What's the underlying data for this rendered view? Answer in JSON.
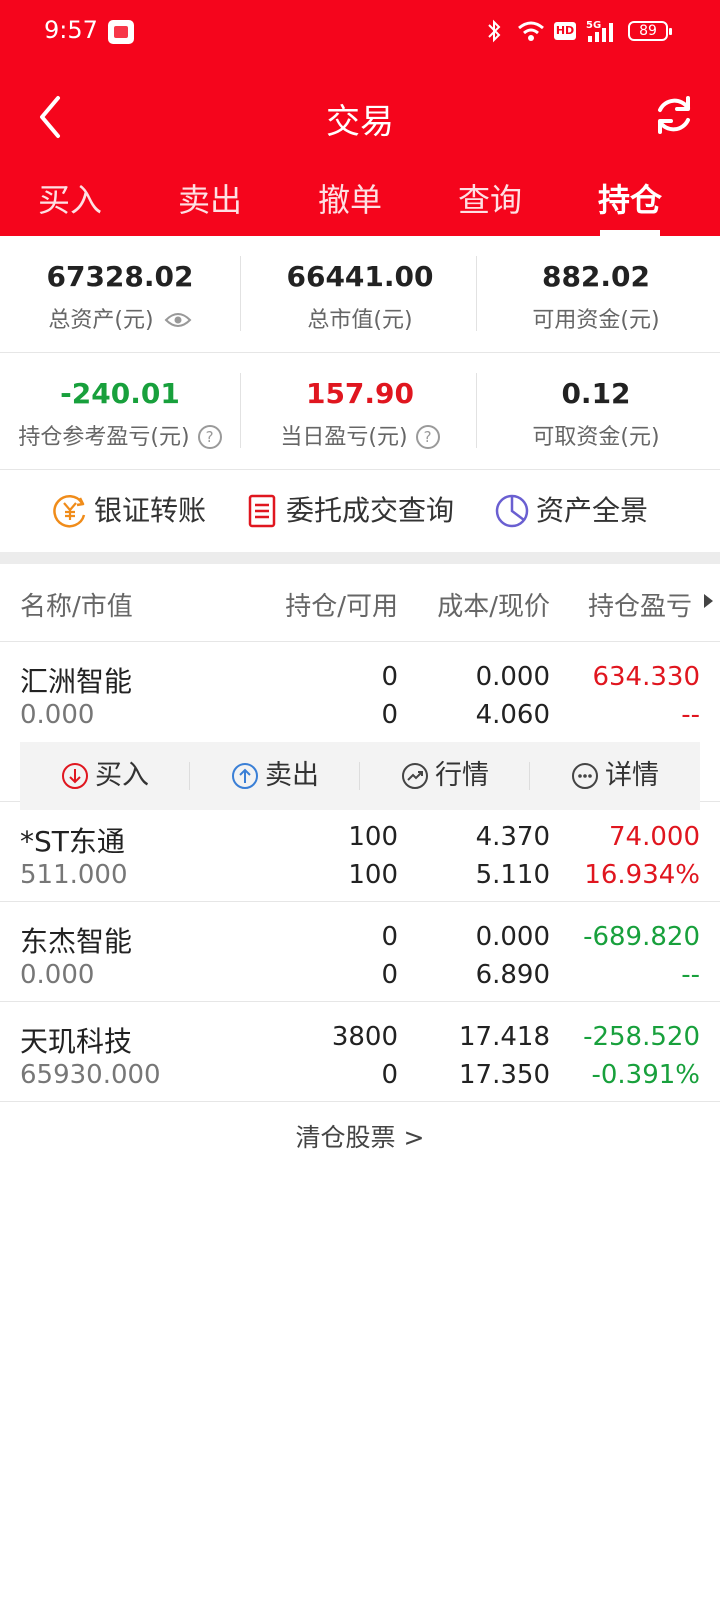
{
  "status_bar": {
    "time": "9:57",
    "battery": "89",
    "hd_label": "HD"
  },
  "header": {
    "title": "交易",
    "back_icon": "chevron-left-icon",
    "refresh_icon": "refresh-icon",
    "bg_color": "#f5051c"
  },
  "tabs": [
    {
      "label": "买入",
      "active": false
    },
    {
      "label": "卖出",
      "active": false
    },
    {
      "label": "撤单",
      "active": false
    },
    {
      "label": "查询",
      "active": false
    },
    {
      "label": "持仓",
      "active": true
    }
  ],
  "summary": {
    "total_assets": {
      "value": "67328.02",
      "label": "总资产(元)"
    },
    "market_value": {
      "value": "66441.00",
      "label": "总市值(元)"
    },
    "available_funds": {
      "value": "882.02",
      "label": "可用资金(元)"
    },
    "position_pnl": {
      "value": "-240.01",
      "label": "持仓参考盈亏(元)"
    },
    "daily_pnl": {
      "value": "157.90",
      "label": "当日盈亏(元)"
    },
    "withdrawable_funds": {
      "value": "0.12",
      "label": "可取资金(元)"
    }
  },
  "quick_actions": [
    {
      "label": "银证转账",
      "icon": "yuan-transfer-icon"
    },
    {
      "label": "委托成交查询",
      "icon": "document-list-icon"
    },
    {
      "label": "资产全景",
      "icon": "pie-chart-icon"
    }
  ],
  "table": {
    "headers": [
      "名称/市值",
      "持仓/可用",
      "成本/现价",
      "持仓盈亏"
    ],
    "rows": [
      {
        "name": "汇洲智能",
        "market_value": "0.000",
        "position": "0",
        "available": "0",
        "cost": "0.000",
        "price": "4.060",
        "pnl": "634.330",
        "pnl_pct": "--",
        "pnl_color": "red",
        "pct_color": "red",
        "expanded": true
      },
      {
        "name": "*ST东通",
        "market_value": "511.000",
        "position": "100",
        "available": "100",
        "cost": "4.370",
        "price": "5.110",
        "pnl": "74.000",
        "pnl_pct": "16.934%",
        "pnl_color": "red",
        "pct_color": "red"
      },
      {
        "name": "东杰智能",
        "market_value": "0.000",
        "position": "0",
        "available": "0",
        "cost": "0.000",
        "price": "6.890",
        "pnl": "-689.820",
        "pnl_pct": "--",
        "pnl_color": "green",
        "pct_color": "green"
      },
      {
        "name": "天玑科技",
        "market_value": "65930.000",
        "position": "3800",
        "available": "0",
        "cost": "17.418",
        "price": "17.350",
        "pnl": "-258.520",
        "pnl_pct": "-0.391%",
        "pnl_color": "green",
        "pct_color": "green"
      }
    ]
  },
  "row_actions": [
    {
      "label": "买入",
      "icon": "arrow-down-circle-icon",
      "color": "#e0161f"
    },
    {
      "label": "卖出",
      "icon": "arrow-up-circle-icon",
      "color": "#3a7fd6"
    },
    {
      "label": "行情",
      "icon": "trend-circle-icon",
      "color": "#444444"
    },
    {
      "label": "详情",
      "icon": "more-circle-icon",
      "color": "#444444"
    }
  ],
  "footer": {
    "clear_link": "清仓股票 >"
  }
}
